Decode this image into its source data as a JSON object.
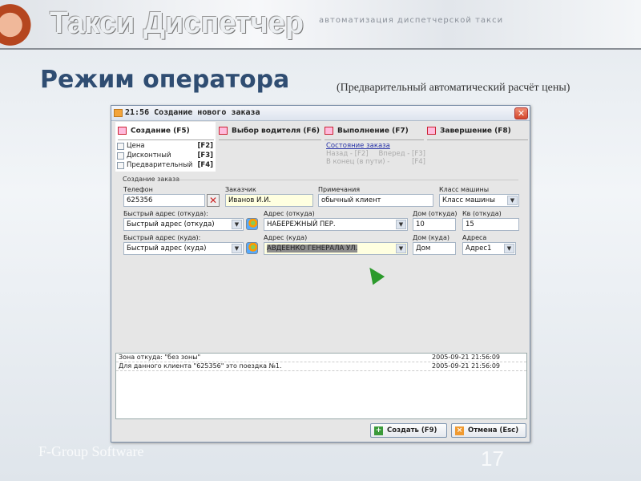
{
  "banner": {
    "brand": "Такси Диспетчер",
    "tagline": "автоматизация диспетчерской такси"
  },
  "page": {
    "title": "Режим оператора",
    "subtitle": "(Предварительный автоматический расчёт цены)",
    "footer": "F-Group Software",
    "number": "17"
  },
  "dialog": {
    "title": "21:56 Создание нового заказа",
    "close": "✕",
    "tabs": [
      {
        "label": "Создание (F5)"
      },
      {
        "label": "Выбор водителя (F6)"
      },
      {
        "label": "Выполнение (F7)"
      },
      {
        "label": "Завершение (F8)"
      }
    ],
    "options": [
      {
        "label": "Цена",
        "key": "[F2]",
        "checked": false
      },
      {
        "label": "Дисконтный",
        "key": "[F3]",
        "checked": false
      },
      {
        "label": "Предварительный",
        "key": "[F4]",
        "checked": false
      }
    ],
    "status": {
      "link": "Состояние заказа",
      "back": "Назад - [F2]",
      "forward": "Вперед - [F3]",
      "end": "В конец (в пути) -",
      "end_key": "[F4]"
    },
    "group": "Создание заказа",
    "fields": {
      "phone": {
        "label": "Телефон",
        "value": "625356"
      },
      "customer": {
        "label": "Заказчик",
        "value": "Иванов И.И."
      },
      "notes": {
        "label": "Примечания",
        "value": "обычный клиент"
      },
      "car_class": {
        "label": "Класс машины",
        "value": "Класс машины"
      },
      "quick_from": {
        "label": "Быстрый адрес (откуда):",
        "value": "Быстрый адрес (откуда)"
      },
      "addr_from": {
        "label": "Адрес (откуда)",
        "value": "НАБЕРЕЖНЫЙ ПЕР."
      },
      "house_from": {
        "label": "Дом (откуда)",
        "value": "10"
      },
      "apt_from": {
        "label": "Кв (откуда)",
        "value": "15"
      },
      "quick_to": {
        "label": "Быстрый адрес (куда):",
        "value": "Быстрый адрес (куда)"
      },
      "addr_to": {
        "label": "Адрес (куда)",
        "value": "АВДЕЕНКО ГЕНЕРАЛА УЛ."
      },
      "house_to": {
        "label": "Дом (куда)",
        "value": "Дом"
      },
      "addresses": {
        "label": "Адреса",
        "value": "Адрес1"
      }
    },
    "log": [
      {
        "text": "Зона откуда: \"без зоны\"",
        "time": "2005-09-21 21:56:09"
      },
      {
        "text": "Для данного клиента \"625356\" это поездка №1.",
        "time": "2005-09-21 21:56:09"
      }
    ],
    "buttons": {
      "create": "Создать (F9)",
      "cancel": "Отмена (Esc)"
    }
  }
}
